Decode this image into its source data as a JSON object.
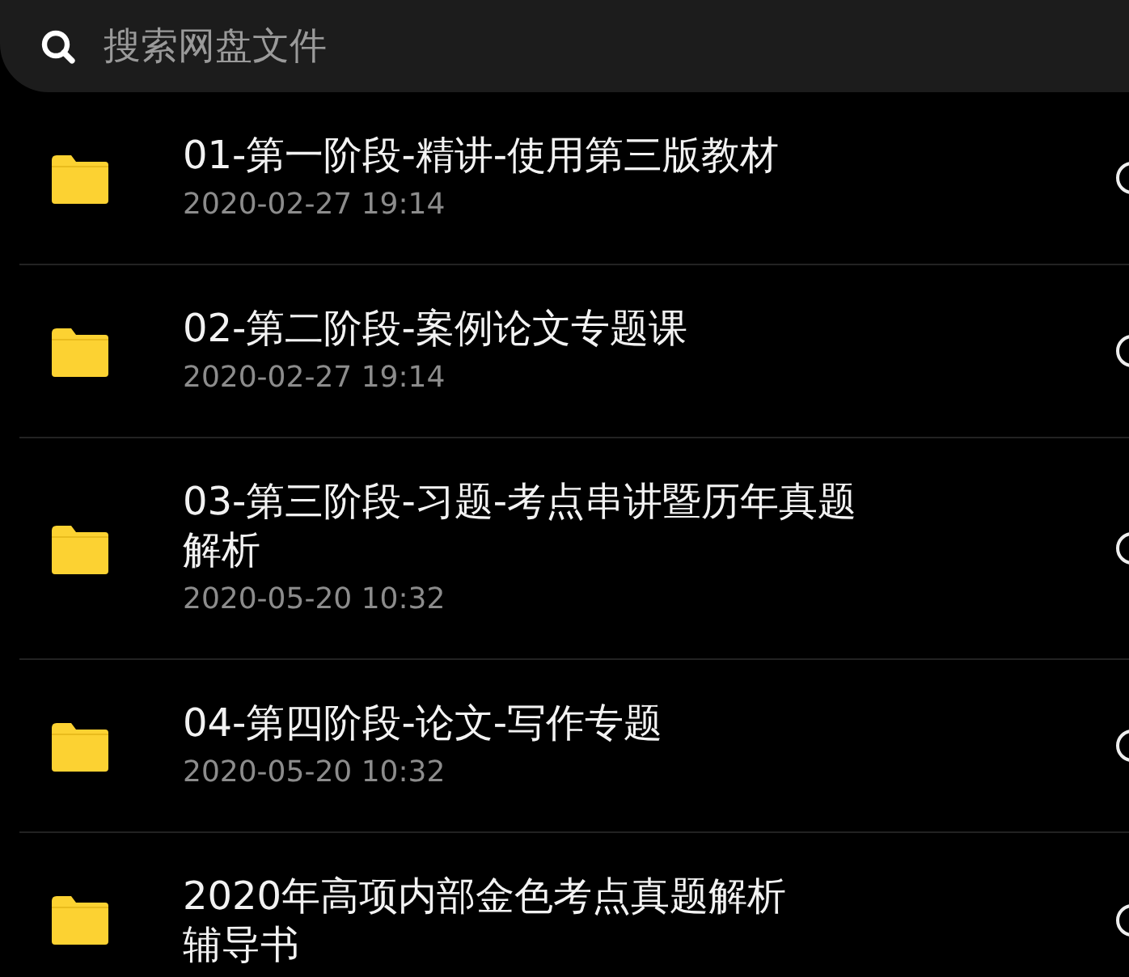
{
  "search": {
    "placeholder": "搜索网盘文件"
  },
  "files": [
    {
      "title_lines": [
        "01-第一阶段-精讲-使用第三版教材"
      ],
      "date": "2020-02-27 19:14",
      "checked": false
    },
    {
      "title_lines": [
        "02-第二阶段-案例论文专题课"
      ],
      "date": "2020-02-27 19:14",
      "checked": false
    },
    {
      "title_lines": [
        "03-第三阶段-习题-考点串讲暨历年真题",
        "解析"
      ],
      "date": "2020-05-20 10:32",
      "checked": false
    },
    {
      "title_lines": [
        "04-第四阶段-论文-写作专题"
      ],
      "date": "2020-05-20 10:32",
      "checked": false
    },
    {
      "title_lines": [
        "2020年高项内部金色考点真题解析",
        "辅导书"
      ],
      "checked": false
    }
  ]
}
